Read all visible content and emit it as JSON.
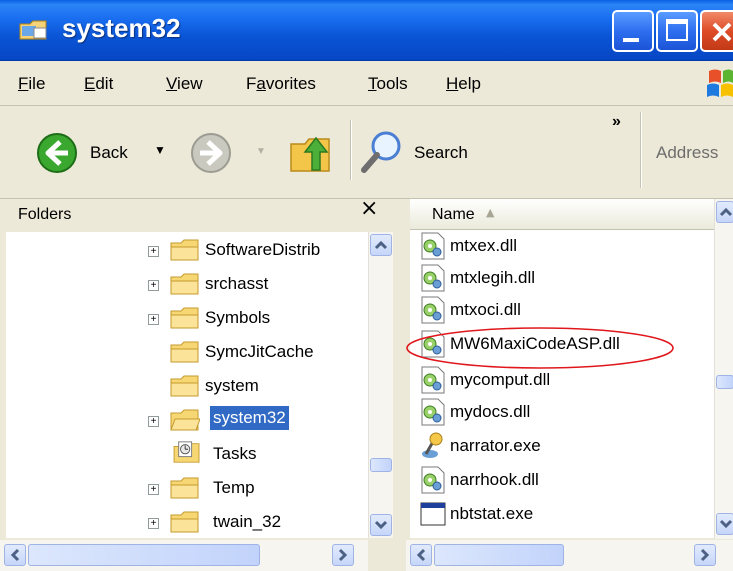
{
  "window": {
    "title": "system32",
    "buttons": [
      "minimize",
      "maximize",
      "close"
    ]
  },
  "menubar": {
    "items": [
      {
        "label": "File",
        "underline": "F",
        "rest": "ile"
      },
      {
        "label": "Edit",
        "underline": "E",
        "rest": "dit"
      },
      {
        "label": "View",
        "underline": "V",
        "rest": "iew"
      },
      {
        "label": "Favorites",
        "pre": "F",
        "underline": "a",
        "rest": "vorites"
      },
      {
        "label": "Tools",
        "underline": "T",
        "rest": "ools"
      },
      {
        "label": "Help",
        "underline": "H",
        "rest": "elp"
      }
    ]
  },
  "toolbar": {
    "back_label": "Back",
    "search_label": "Search",
    "overflow": "»",
    "address_label": "Address"
  },
  "folders": {
    "title": "Folders",
    "close": "×",
    "items": [
      {
        "label": "SoftwareDistrib",
        "expander": "+",
        "icon": "folder-icon"
      },
      {
        "label": "srchasst",
        "expander": "+",
        "icon": "folder-icon"
      },
      {
        "label": "Symbols",
        "expander": "+",
        "icon": "folder-icon"
      },
      {
        "label": "SymcJitCache",
        "expander": "",
        "icon": "folder-icon"
      },
      {
        "label": "system",
        "expander": "",
        "icon": "folder-icon"
      },
      {
        "label": "system32",
        "expander": "+",
        "icon": "open-folder-icon",
        "selected": true
      },
      {
        "label": "Tasks",
        "expander": "",
        "icon": "tasks-folder-icon"
      },
      {
        "label": "Temp",
        "expander": "+",
        "icon": "folder-icon"
      },
      {
        "label": "twain_32",
        "expander": "+",
        "icon": "folder-icon"
      }
    ]
  },
  "files": {
    "column": "Name",
    "items": [
      {
        "label": "mtxex.dll",
        "icon": "dll-icon"
      },
      {
        "label": "mtxlegih.dll",
        "icon": "dll-icon"
      },
      {
        "label": "mtxoci.dll",
        "icon": "dll-icon"
      },
      {
        "label": "MW6MaxiCodeASP.dll",
        "icon": "dll-icon",
        "circled": true
      },
      {
        "label": "mycomput.dll",
        "icon": "dll-icon"
      },
      {
        "label": "mydocs.dll",
        "icon": "dll-icon"
      },
      {
        "label": "narrator.exe",
        "icon": "narrator-exe-icon"
      },
      {
        "label": "narrhook.dll",
        "icon": "dll-icon"
      },
      {
        "label": "nbtstat.exe",
        "icon": "console-exe-icon"
      }
    ]
  },
  "colors": {
    "titlebar": "#0a55d6",
    "selection": "#316ac5",
    "highlight_ellipse": "#e0181c"
  }
}
